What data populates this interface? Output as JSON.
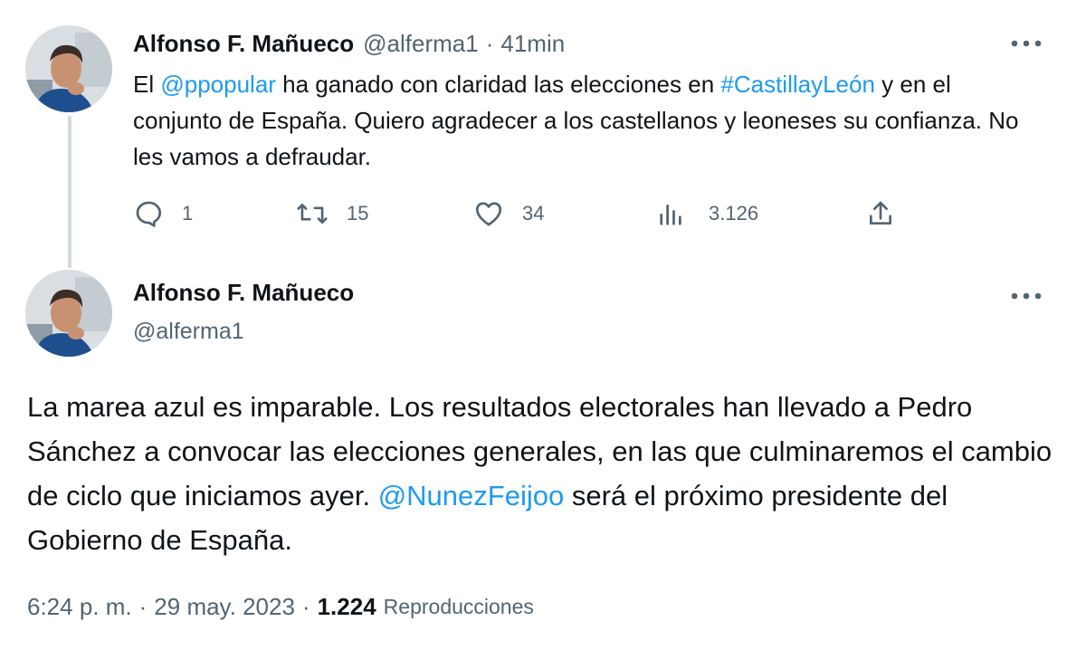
{
  "tweet1": {
    "author_name": "Alfonso F. Mañueco",
    "author_handle": "@alferma1",
    "separator": "·",
    "time": "41min",
    "text": {
      "part1": "El ",
      "mention1": "@ppopular",
      "part2": " ha ganado con claridad las elecciones en ",
      "hashtag1": "#CastillayLeón",
      "part3": " y en el conjunto de España. Quiero agradecer a los castellanos y leoneses su confianza. No les vamos a defraudar."
    },
    "actions": {
      "reply_count": "1",
      "retweet_count": "15",
      "like_count": "34",
      "views_count": "3.126"
    },
    "icons": [
      "reply-icon",
      "retweet-icon",
      "like-icon",
      "views-icon",
      "share-icon",
      "more-icon"
    ]
  },
  "tweet2": {
    "author_name": "Alfonso F. Mañueco",
    "author_handle": "@alferma1",
    "text": {
      "part1": "La marea azul es imparable. Los resultados electorales han llevado a Pedro Sánchez a convocar las elecciones generales, en las que culminaremos el cambio de ciclo que iniciamos ayer. ",
      "mention1": "@NunezFeijoo",
      "part2": " será el próximo presidente del Gobierno de España."
    },
    "meta": {
      "time": "6:24 p. m.",
      "sep1": "·",
      "date": "29 may. 2023",
      "sep2": "·",
      "views_count": "1.224",
      "views_label": "Reproducciones"
    }
  },
  "colors": {
    "link": "#1d9bf0",
    "text_primary": "#0f1419",
    "text_secondary": "#536471",
    "thread_line": "#cfd9de"
  }
}
